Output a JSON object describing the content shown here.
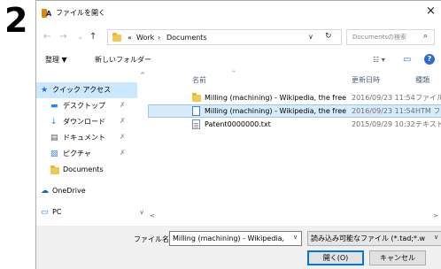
{
  "step_number": "2",
  "window": {
    "title": "ファイルを開く",
    "app_icon": "app-icon",
    "close_glyph": "×"
  },
  "nav_buttons": {
    "back": "←",
    "forward": "→",
    "recent": "⌄",
    "up": "↑"
  },
  "address": {
    "crumb_sep": "«",
    "crumbs": [
      "Work",
      "Documents"
    ],
    "arrow": "›",
    "dropdown_glyph": "∨",
    "refresh_glyph": "↻"
  },
  "search": {
    "placeholder": "Documentsの検索",
    "icon": "⌕"
  },
  "toolbar": {
    "organize": "整理 ▼",
    "new_folder": "新しいフォルダー",
    "view_icons": "☷ ▾",
    "preview_icon": "▭",
    "help": "?"
  },
  "sidebar": {
    "items": [
      {
        "label": "クイック アクセス",
        "icon": "★",
        "selected": true,
        "sub": false,
        "pinned": false
      },
      {
        "label": "デスクトップ",
        "icon": "▬",
        "selected": false,
        "sub": true,
        "pinned": true
      },
      {
        "label": "ダウンロード",
        "icon": "↓",
        "selected": false,
        "sub": true,
        "pinned": true
      },
      {
        "label": "ドキュメント",
        "icon": "▤",
        "selected": false,
        "sub": true,
        "pinned": true
      },
      {
        "label": "ピクチャ",
        "icon": "▨",
        "selected": false,
        "sub": true,
        "pinned": true
      },
      {
        "label": "Documents",
        "icon": "folder",
        "selected": false,
        "sub": true,
        "pinned": false
      },
      {
        "label": "OneDrive",
        "icon": "☁",
        "selected": false,
        "sub": false,
        "pinned": false
      },
      {
        "label": "PC",
        "icon": "▭",
        "selected": false,
        "sub": false,
        "pinned": false
      }
    ],
    "pin_glyph": "✗"
  },
  "file_list": {
    "columns": {
      "name": "名前",
      "modified": "更新日時",
      "type": "種類"
    },
    "rows": [
      {
        "name": "Milling (machining) - Wikipedia, the free ...",
        "modified": "2016/09/23 11:54",
        "type": "ファイル フォ",
        "icon": "folder",
        "selected": false
      },
      {
        "name": "Milling (machining) - Wikipedia, the free ...",
        "modified": "2016/09/23 11:54",
        "type": "HTM ファ",
        "icon": "htm",
        "selected": true
      },
      {
        "name": "Patent0000000.txt",
        "modified": "2015/09/29 10:32",
        "type": "テキスト ド",
        "icon": "txt",
        "selected": false
      }
    ]
  },
  "footer": {
    "filename_label": "ファイル名(N):",
    "filename_value": "Milling (machining) - Wikipedia,",
    "filetype_value": "読み込み可能なファイル (*.tad;*.w",
    "open_button": "開く(O)",
    "cancel_button": "キャンセル"
  },
  "colors": {
    "accent": "#0078d7",
    "selection": "#cce8ff",
    "help": "#2b6cd4"
  }
}
